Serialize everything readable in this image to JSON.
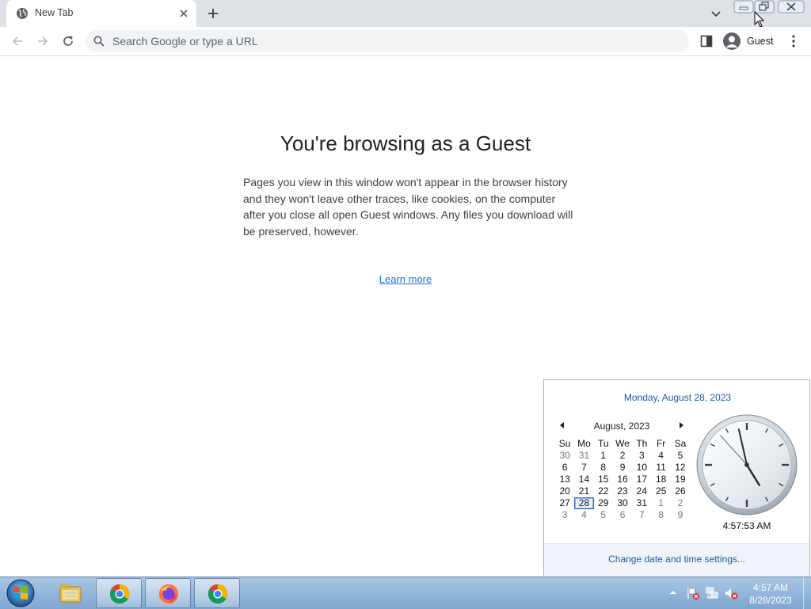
{
  "browser": {
    "tab": {
      "title": "New Tab"
    },
    "omnibox": {
      "placeholder": "Search Google or type a URL"
    },
    "profile": {
      "label": "Guest"
    },
    "icons": {
      "tab_favicon": "globe-icon",
      "new_tab": "plus-icon",
      "tab_search": "chevron-down-icon",
      "back": "arrow-left-icon",
      "forward": "arrow-right-icon",
      "reload": "reload-icon",
      "search": "search-icon",
      "side_panel": "side-panel-icon",
      "menu": "kebab-menu-icon"
    }
  },
  "page": {
    "heading": "You're browsing as a Guest",
    "body": "Pages you view in this window won't appear in the browser history and they won't leave other traces, like cookies, on the computer after you close all open Guest windows. Any files you download will be preserved, however.",
    "learn_more": "Learn more"
  },
  "calendar_flyout": {
    "long_date": "Monday, August 28, 2023",
    "month_label": "August, 2023",
    "weekdays": [
      "Su",
      "Mo",
      "Tu",
      "We",
      "Th",
      "Fr",
      "Sa"
    ],
    "weeks": [
      [
        {
          "d": "30",
          "other": true
        },
        {
          "d": "31",
          "other": true
        },
        {
          "d": "1"
        },
        {
          "d": "2"
        },
        {
          "d": "3"
        },
        {
          "d": "4"
        },
        {
          "d": "5"
        }
      ],
      [
        {
          "d": "6"
        },
        {
          "d": "7"
        },
        {
          "d": "8"
        },
        {
          "d": "9"
        },
        {
          "d": "10"
        },
        {
          "d": "11"
        },
        {
          "d": "12"
        }
      ],
      [
        {
          "d": "13"
        },
        {
          "d": "14"
        },
        {
          "d": "15"
        },
        {
          "d": "16"
        },
        {
          "d": "17"
        },
        {
          "d": "18"
        },
        {
          "d": "19"
        }
      ],
      [
        {
          "d": "20"
        },
        {
          "d": "21"
        },
        {
          "d": "22"
        },
        {
          "d": "23"
        },
        {
          "d": "24"
        },
        {
          "d": "25"
        },
        {
          "d": "26"
        }
      ],
      [
        {
          "d": "27"
        },
        {
          "d": "28",
          "today": true
        },
        {
          "d": "29"
        },
        {
          "d": "30"
        },
        {
          "d": "31"
        },
        {
          "d": "1",
          "other": true
        },
        {
          "d": "2",
          "other": true
        }
      ],
      [
        {
          "d": "3",
          "other": true
        },
        {
          "d": "4",
          "other": true
        },
        {
          "d": "5",
          "other": true
        },
        {
          "d": "6",
          "other": true
        },
        {
          "d": "7",
          "other": true
        },
        {
          "d": "8",
          "other": true
        },
        {
          "d": "9",
          "other": true
        }
      ]
    ],
    "clock_time": "4:57:53 AM",
    "clock_hands": {
      "hour": 4,
      "minute": 57,
      "second": 53
    },
    "settings_link": "Change date and time settings..."
  },
  "taskbar": {
    "items": [
      {
        "name": "file-explorer",
        "icon": "folder-icon",
        "active": false
      },
      {
        "name": "chrome",
        "icon": "chrome-icon",
        "active": true
      },
      {
        "name": "firefox",
        "icon": "firefox-icon",
        "active": true
      },
      {
        "name": "chrome-guest",
        "icon": "chrome-icon",
        "active": true
      }
    ],
    "tray": {
      "icons": [
        "action-center-flag-icon",
        "network-icon",
        "volume-muted-icon"
      ],
      "time": "4:57 AM",
      "date": "8/28/2023"
    }
  },
  "colors": {
    "tabstrip": "#dee1e6",
    "omnibox": "#f1f3f4",
    "link": "#1a73e8",
    "flyout_link": "#1e5aa8",
    "taskbar": "#8fb2d9"
  }
}
